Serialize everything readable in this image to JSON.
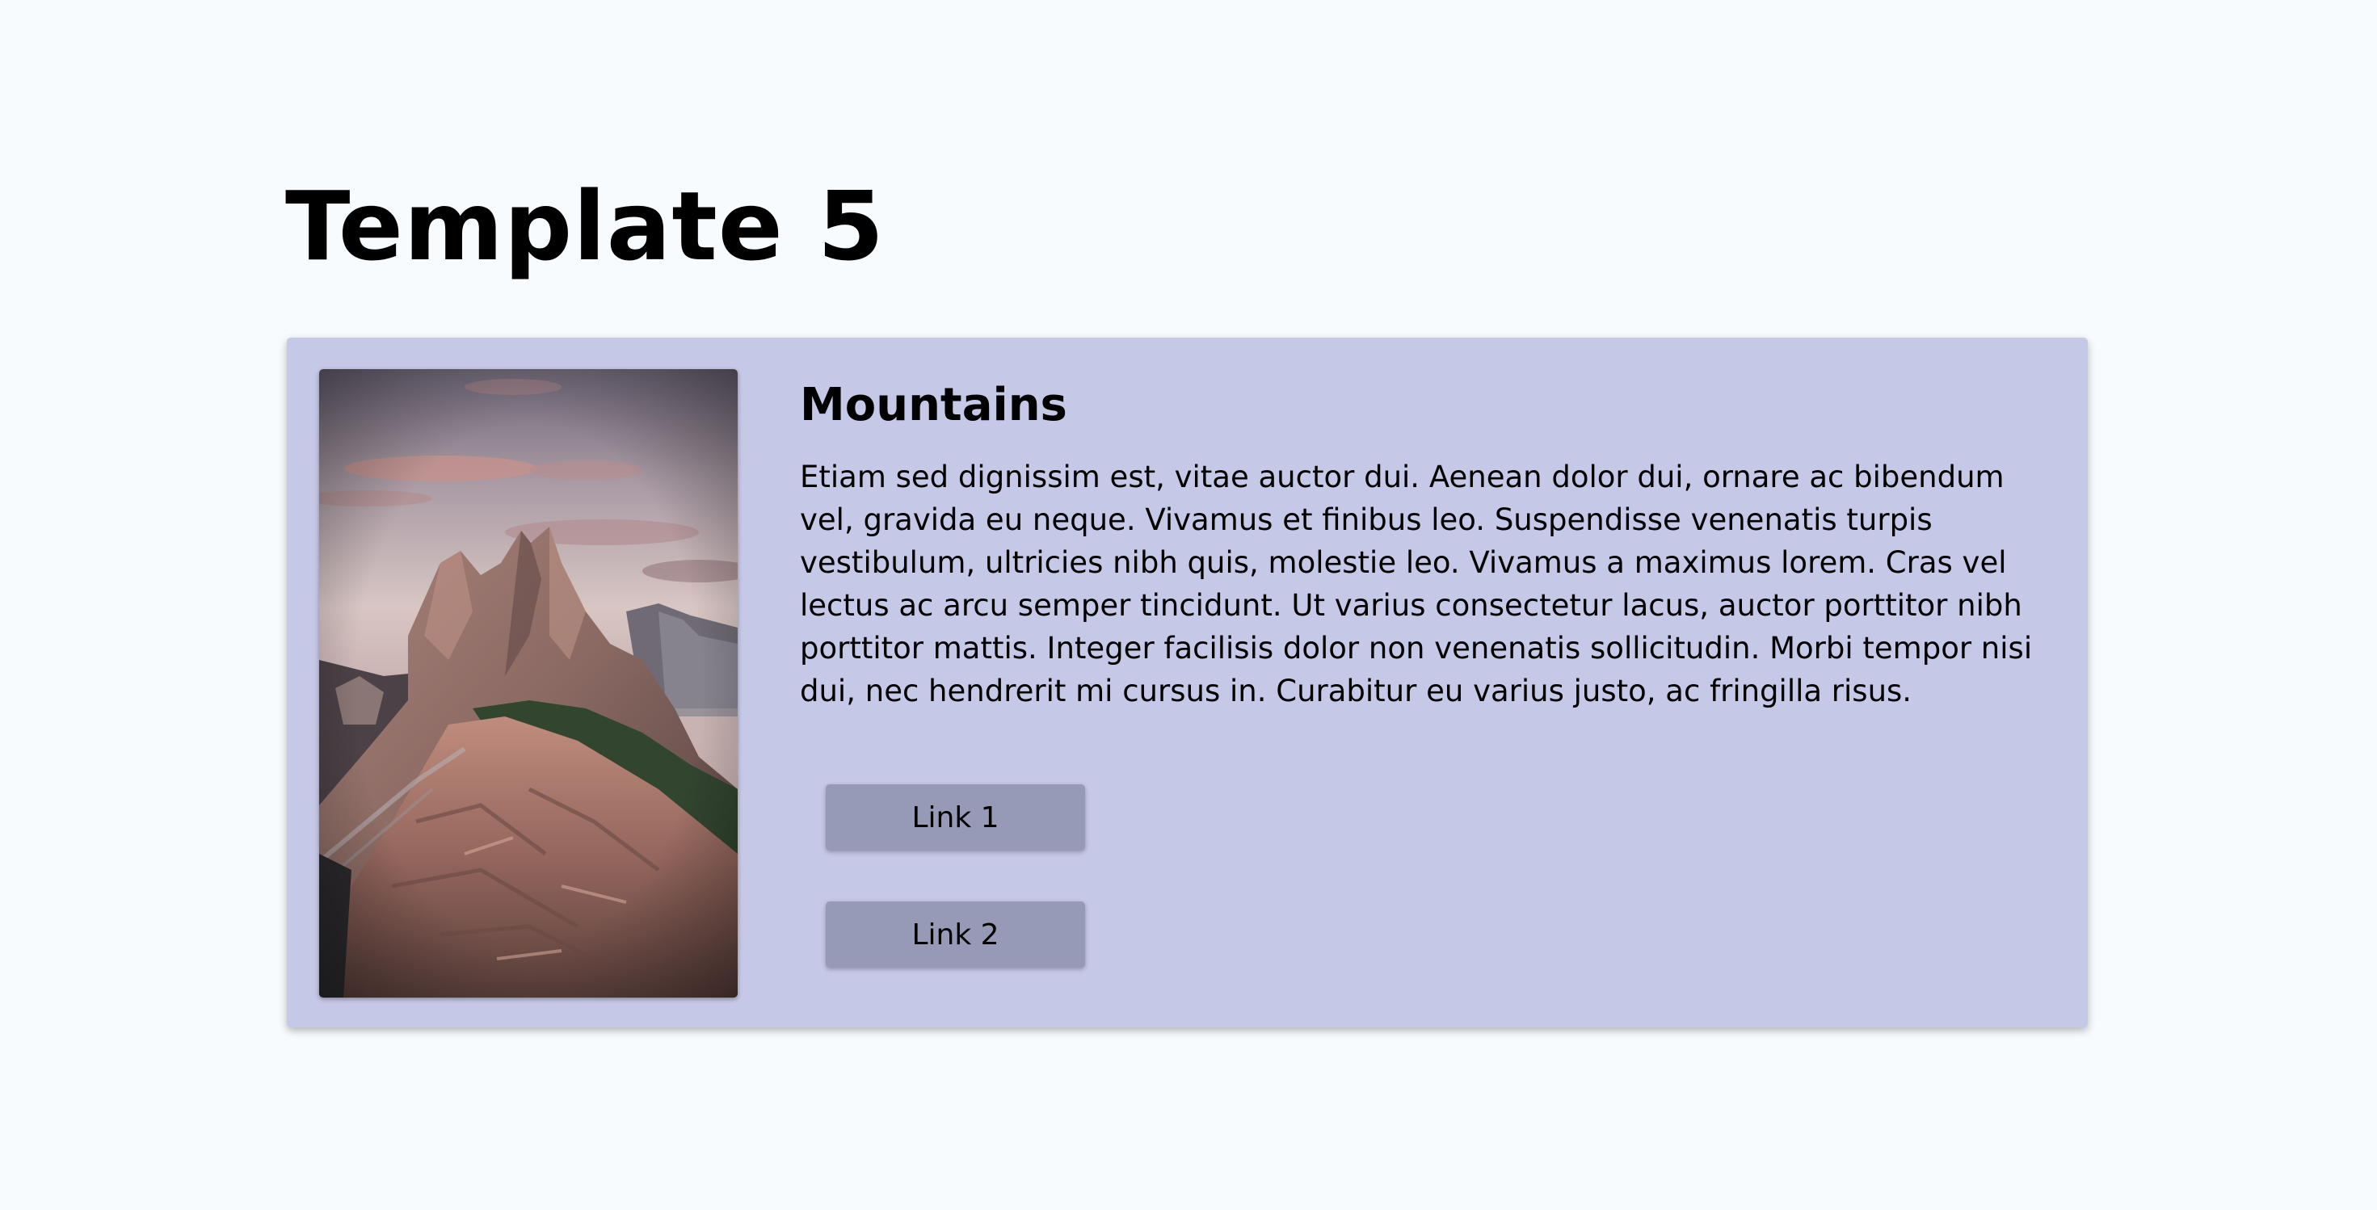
{
  "page": {
    "title": "Template 5"
  },
  "card": {
    "title": "Mountains",
    "body": "Etiam sed dignissim est, vitae auctor dui. Aenean dolor dui, ornare ac bibendum vel, gravida eu neque. Vivamus et finibus leo. Suspendisse venenatis turpis vestibulum, ultricies nibh quis, molestie leo. Vivamus a maximus lorem. Cras vel lectus ac arcu semper tincidunt. Ut varius consectetur lacus, auctor porttitor nibh porttitor mattis. Integer facilisis dolor non venenatis sollicitudin. Morbi tempor nisi dui, nec hendrerit mi cursus in. Curabitur eu varius justo, ac fringilla risus.",
    "image_icon": "mountain-photo",
    "links": [
      {
        "label": "Link 1"
      },
      {
        "label": "Link 2"
      }
    ]
  },
  "colors": {
    "page_background": "#f7fbfe",
    "card_background": "#c6c8e7",
    "button_background": "#979ab6"
  }
}
